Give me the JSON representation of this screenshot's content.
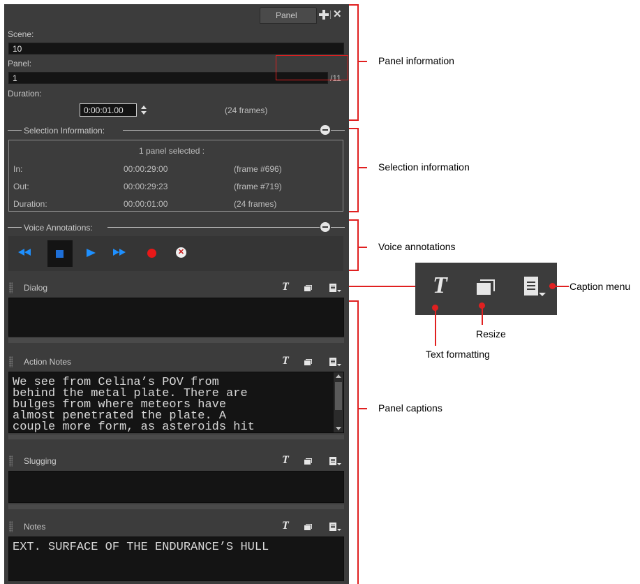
{
  "panel_tab": {
    "label": "Panel"
  },
  "colors": {
    "panel_bg": "#3c3c3c",
    "field_bg": "#141414",
    "accent_blue": "#1e90ff",
    "record_red": "#e81818",
    "annotation_red": "#e02020"
  },
  "panel_info": {
    "scene_label": "Scene:",
    "scene_value": "10",
    "panel_label": "Panel:",
    "panel_value": "1",
    "panel_total": "/11",
    "duration_label": "Duration:",
    "duration_value": "0:00:01.00",
    "duration_frames": "(24 frames)"
  },
  "selection": {
    "header": "Selection Information:",
    "summary": "1 panel selected :",
    "rows": [
      {
        "label": "In:",
        "time": "00:00:29:00",
        "frames": "(frame #696)"
      },
      {
        "label": "Out:",
        "time": "00:00:29:23",
        "frames": "(frame #719)"
      },
      {
        "label": "Duration:",
        "time": "00:00:01:00",
        "frames": "(24 frames)"
      }
    ]
  },
  "voice": {
    "header": "Voice Annotations:",
    "controls": [
      "rewind-icon",
      "stop-icon",
      "play-icon",
      "fast-forward-icon",
      "record-icon",
      "delete-audio-icon"
    ]
  },
  "captions": [
    {
      "title": "Dialog",
      "text": ""
    },
    {
      "title": "Action Notes",
      "text": "We see from Celina’s POV from\nbehind the metal plate. There are\nbulges from where meteors have\nalmost penetrated the plate. A\ncouple more form, as asteroids hit"
    },
    {
      "title": "Slugging",
      "text": ""
    },
    {
      "title": "Notes",
      "text": "EXT. SURFACE OF THE ENDURANCE’S HULL"
    }
  ],
  "annotations": {
    "panel_information": "Panel information",
    "selection_information": "Selection information",
    "voice_annotations": "Voice annotations",
    "panel_captions": "Panel captions",
    "caption_menu": "Caption menu",
    "resize": "Resize",
    "text_formatting": "Text formatting"
  }
}
